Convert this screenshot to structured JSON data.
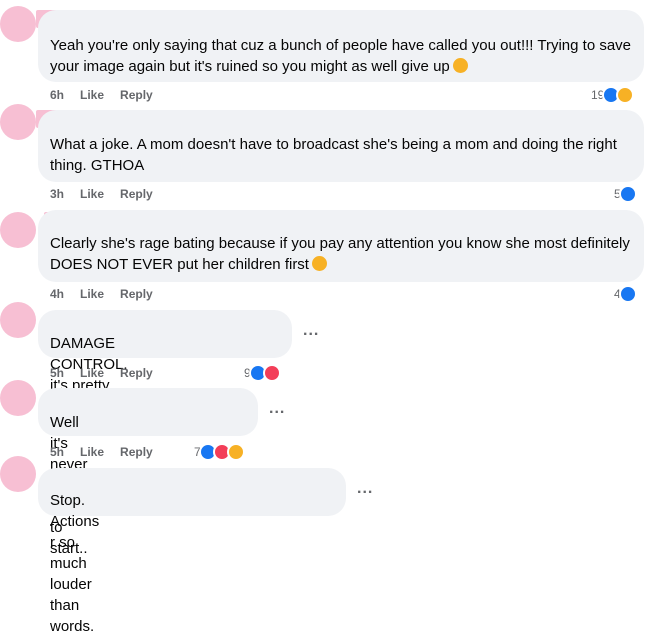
{
  "comments": [
    {
      "text_lines": [
        "Yeah you're only saying that cuz a bunch of people have called you out!!! Trying to save",
        "your image again but it's ruined so you might as well give up"
      ],
      "time": "6h",
      "like": "Like",
      "reply": "Reply",
      "reaction_count": "19",
      "reactions": [
        "like-icon",
        "haha-icon"
      ],
      "emoji": "laughing-emoji"
    },
    {
      "text_lines": [
        "What a joke. A mom doesn't have to broadcast she's being a mom and doing the right",
        "thing. GTHOA"
      ],
      "time": "3h",
      "like": "Like",
      "reply": "Reply",
      "reaction_count": "5",
      "reactions": [
        "like-icon"
      ]
    },
    {
      "text_lines": [
        "Clearly she's rage bating because if you pay any attention you know she most definitely",
        "DOES NOT EVER put her children first"
      ],
      "time": "4h",
      "like": "Like",
      "reply": "Reply",
      "reaction_count": "4",
      "reactions": [
        "like-icon"
      ],
      "emoji": "smiling-emoji"
    },
    {
      "text_lines": [
        "DAMAGE CONTROL. it's pretty sad."
      ],
      "time": "5h",
      "like": "Like",
      "reply": "Reply",
      "reaction_count": "9",
      "reactions": [
        "like-icon",
        "love-icon"
      ]
    },
    {
      "text_lines": [
        "Well it's never to late to start.."
      ],
      "time": "5h",
      "like": "Like",
      "reply": "Reply",
      "reaction_count": "7",
      "reactions": [
        "like-icon",
        "love-icon",
        "haha-icon"
      ]
    },
    {
      "text_lines": [
        "Stop. Actions r so much louder than words."
      ],
      "more": "..."
    }
  ],
  "more_label": "...",
  "colors": {
    "like": "#1877f2",
    "love": "#f33e58",
    "haha": "#f7b125",
    "bubble": "#f0f2f5",
    "redaction": "#f7bfd3"
  }
}
